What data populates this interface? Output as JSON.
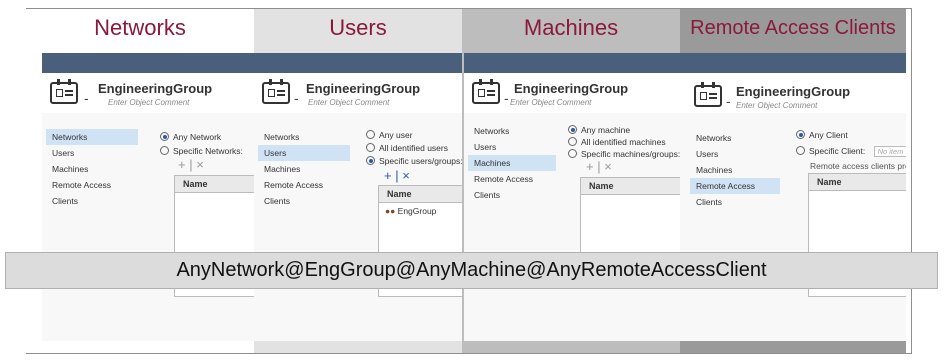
{
  "columns": [
    {
      "title": "Networks",
      "object_name": "EngineeringGroup",
      "comment_placeholder": "Enter Object Comment",
      "nav": [
        "Networks",
        "Users",
        "Machines",
        "Remote Access Clients"
      ],
      "selected_nav": 0,
      "options": [
        "Any Network",
        "Specific Networks:"
      ],
      "selected_option": 0,
      "grid_header": "Name",
      "rows": []
    },
    {
      "title": "Users",
      "object_name": "EngineeringGroup",
      "comment_placeholder": "Enter Object Comment",
      "nav": [
        "Networks",
        "Users",
        "Machines",
        "Remote Access Clients"
      ],
      "selected_nav": 1,
      "options": [
        "Any user",
        "All identified users",
        "Specific users/groups:"
      ],
      "selected_option": 2,
      "grid_header": "Name",
      "rows": [
        "EngGroup"
      ]
    },
    {
      "title": "Machines",
      "object_name": "EngineeringGroup",
      "comment_placeholder": "Enter Object Comment",
      "nav": [
        "Networks",
        "Users",
        "Machines",
        "Remote Access Clients"
      ],
      "selected_nav": 2,
      "options": [
        "Any machine",
        "All identified machines",
        "Specific machines/groups:"
      ],
      "selected_option": 0,
      "grid_header": "Name",
      "rows": []
    },
    {
      "title": "Remote Access Clients",
      "object_name": "EngineeringGroup",
      "comment_placeholder": "Enter Object Comment",
      "nav": [
        "Networks",
        "Users",
        "Machines",
        "Remote Access Clients"
      ],
      "selected_nav": 3,
      "options": [
        "Any Client",
        "Specific Client:"
      ],
      "selected_option": 0,
      "specific_client_placeholder": "No item",
      "note": "Remote access clients prev",
      "grid_header": "Name",
      "rows": []
    }
  ],
  "toolbar": {
    "add": "+",
    "remove": "×"
  },
  "banner": "AnyNetwork@EngGroup@AnyMachine@AnyRemoteAccessClient",
  "colors": {
    "title": "#8b1a3a",
    "topbar": "#4a5f7b",
    "selection": "#cfe3f5",
    "col1": "#ffffff",
    "col2": "#e2e2e2",
    "col3": "#bdbdbd",
    "col4": "#9a9a9a"
  }
}
